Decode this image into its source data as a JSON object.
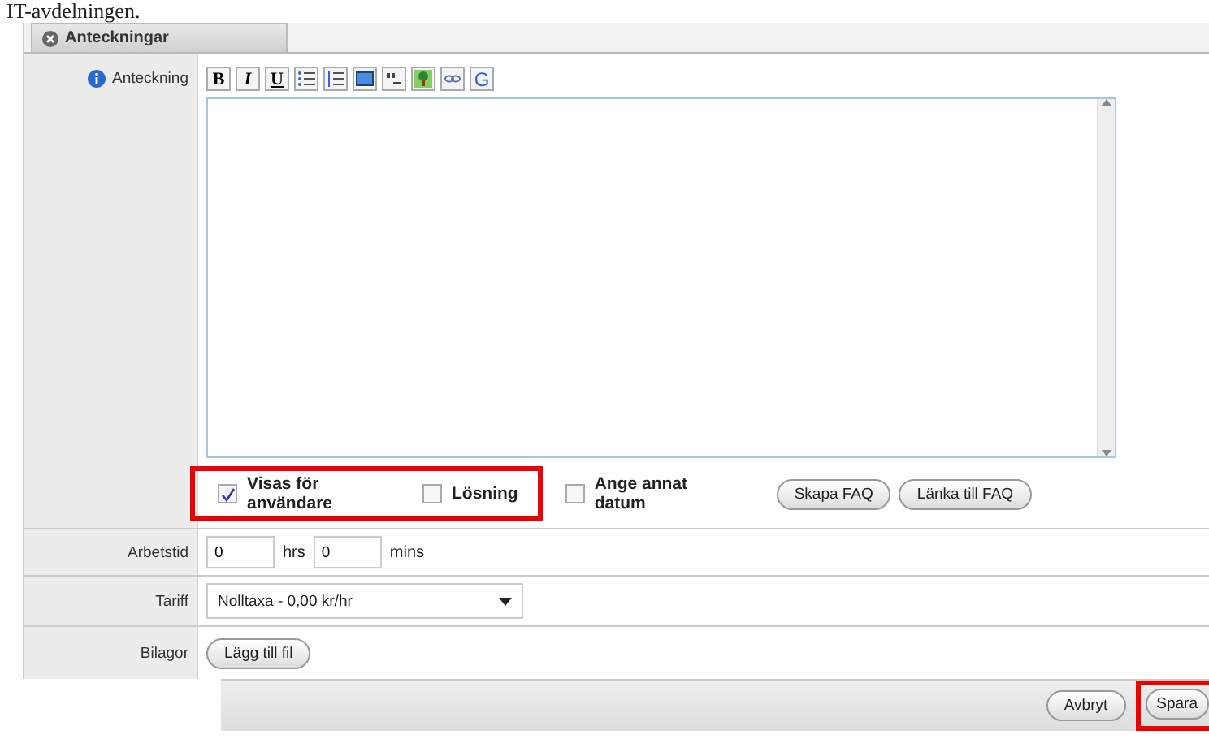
{
  "caption": "IT-avdelningen.",
  "tab": {
    "label": "Anteckningar"
  },
  "note": {
    "label": "Anteckning",
    "toolbar": [
      {
        "kind": "bold",
        "label": "B"
      },
      {
        "kind": "italic",
        "label": "I"
      },
      {
        "kind": "underline",
        "label": "U"
      },
      {
        "kind": "bullets"
      },
      {
        "kind": "numbers"
      },
      {
        "kind": "media"
      },
      {
        "kind": "quote"
      },
      {
        "kind": "image"
      },
      {
        "kind": "link"
      },
      {
        "kind": "letter",
        "label": "G"
      }
    ],
    "highlighted_options": [
      {
        "label": "Visas för användare",
        "checked": true
      },
      {
        "label": "Lösning",
        "checked": false
      }
    ],
    "other_options": [
      {
        "label": "Ange annat datum",
        "checked": false
      }
    ],
    "buttons": [
      "Skapa FAQ",
      "Länka till FAQ"
    ]
  },
  "worktime": {
    "label": "Arbetstid",
    "hours": "0",
    "hours_unit": "hrs",
    "minutes": "0",
    "minutes_unit": "mins"
  },
  "tariff": {
    "label": "Tariff",
    "value": "Nolltaxa - 0,00 kr/hr"
  },
  "attachments": {
    "label": "Bilagor",
    "button": "Lägg till fil"
  },
  "footer": {
    "buttons": [
      {
        "label": "Avbryt",
        "highlighted": false
      },
      {
        "label": "Spara",
        "highlighted": true
      }
    ]
  }
}
